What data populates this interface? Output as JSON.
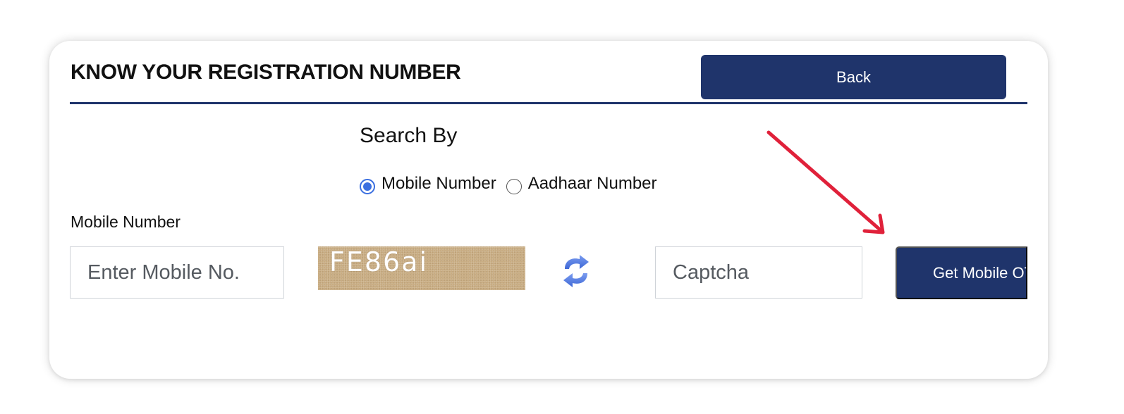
{
  "header": {
    "title": "KNOW YOUR REGISTRATION NUMBER",
    "back_label": "Back"
  },
  "search": {
    "label": "Search By",
    "options": [
      {
        "label": "Mobile Number",
        "selected": true
      },
      {
        "label": "Aadhaar Number",
        "selected": false
      }
    ]
  },
  "form": {
    "mobile_label": "Mobile Number",
    "mobile_placeholder": "Enter Mobile No.",
    "captcha_text": "FE86ai",
    "captcha_placeholder": "Captcha",
    "submit_label": "Get Mobile OTP"
  },
  "icons": {
    "refresh": "refresh-icon",
    "annotation": "red-arrow"
  },
  "colors": {
    "primary": "#1f346b",
    "radio_accent": "#3b6fe0",
    "annotation_arrow": "#e0213a"
  }
}
